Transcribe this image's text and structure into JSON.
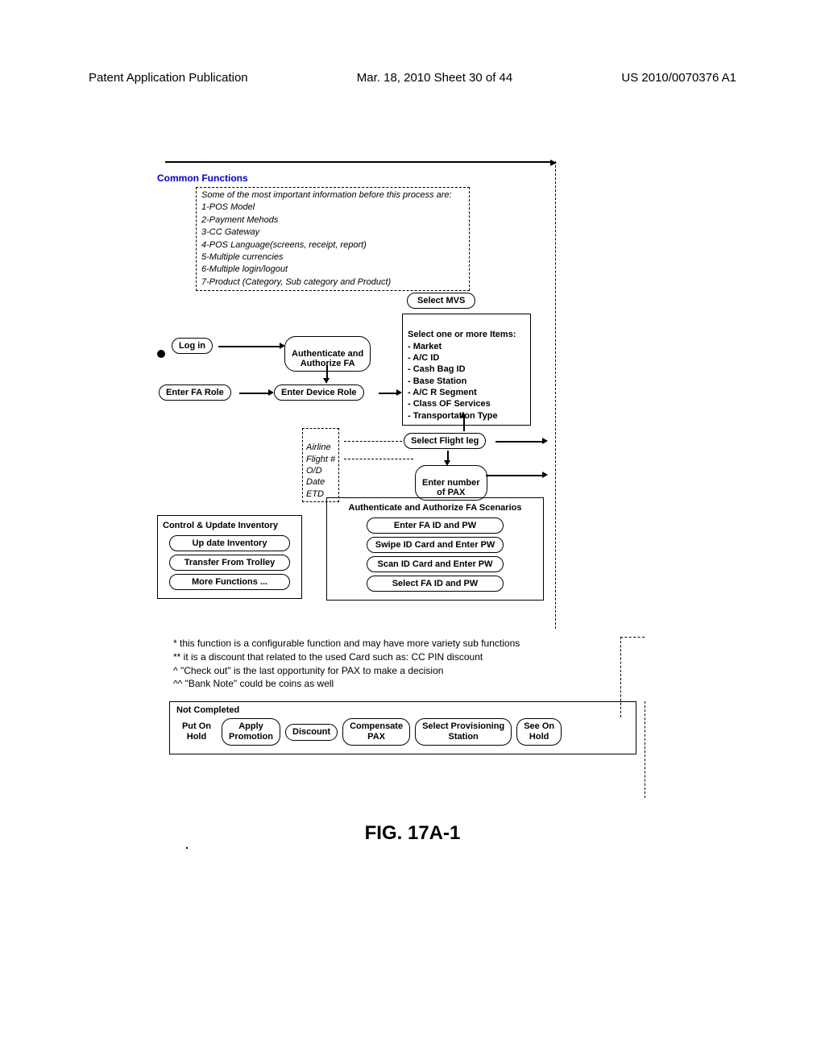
{
  "header": {
    "left": "Patent Application Publication",
    "center": "Mar. 18, 2010  Sheet 30 of 44",
    "right": "US 2010/0070376 A1"
  },
  "section_title": "Common Functions",
  "info_lines": [
    "Some of the most important information before this process are:",
    "1-POS Model",
    "2-Payment Mehods",
    "3-CC Gateway",
    "4-POS Language(screens, receipt, report)",
    "5-Multiple currencies",
    "6-Multiple login/logout",
    "7-Product (Category, Sub category and Product)"
  ],
  "nodes": {
    "login": "Log in",
    "auth": "Authenticate and\nAuthorize FA",
    "enter_fa_role": "Enter FA Role",
    "enter_device_role": "Enter Device Role",
    "select_mvs": "Select MVS",
    "mvs_items": "Select one or more Items:\n- Market\n- A/C ID\n- Cash Bag ID\n- Base Station\n- A/C R Segment\n- Class OF Services\n- Transportation Type",
    "select_flight_leg": "Select Flight leg",
    "enter_pax": "Enter number\nof PAX",
    "flight_info": "Airline\nFlight #\nO/D\nDate\nETD",
    "scenarios_title": "Authenticate and Authorize FA Scenarios",
    "scenario_1": "Enter FA ID and PW",
    "scenario_2": "Swipe ID Card and Enter PW",
    "scenario_3": "Scan ID Card and Enter PW",
    "scenario_4": "Select FA ID and PW",
    "inventory_title": "Control & Update Inventory",
    "inventory_1": "Up date Inventory",
    "inventory_2": "Transfer From Trolley",
    "inventory_3": "More Functions ..."
  },
  "footnotes": [
    "* this function is a configurable function and may have more variety sub functions",
    "** it is a discount that related to the used Card such as: CC PIN discount",
    "^ \"Check out\" is the last opportunity for PAX to make a decision",
    "^^ \"Bank Note\" could be coins as well"
  ],
  "not_completed": {
    "title": "Not Completed",
    "put_on_hold": "Put On\nHold",
    "apply_promotion": "Apply\nPromotion",
    "discount": "Discount",
    "compensate_pax": "Compensate\nPAX",
    "select_provisioning": "Select Provisioning\nStation",
    "see_on_hold": "See On\nHold"
  },
  "figure_label": "FIG. 17A-1"
}
